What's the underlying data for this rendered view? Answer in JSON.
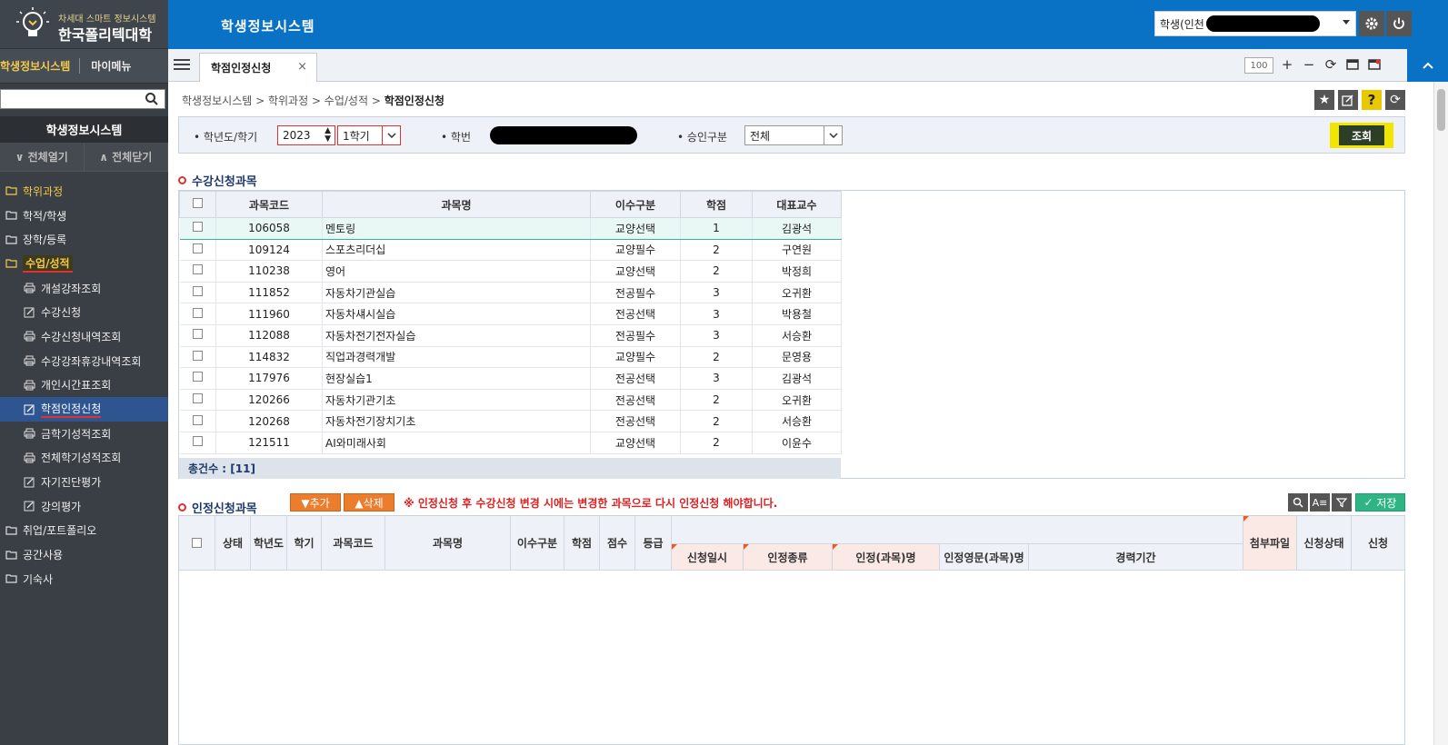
{
  "brand": {
    "subtitle": "차세대 스마트 정보시스템",
    "name": "한국폴리텍대학"
  },
  "sidebar": {
    "tab_active": "학생정보시스템",
    "tab_other": "마이메뉴",
    "search_placeholder": "",
    "menu_title": "학생정보시스템",
    "expand_all": "전체열기",
    "collapse_all": "전체닫기",
    "root": "학위과정",
    "items": [
      {
        "label": "학적/학생",
        "level": 0
      },
      {
        "label": "장학/등록",
        "level": 0
      },
      {
        "label": "수업/성적",
        "level": 0,
        "open": true
      },
      {
        "label": "개설강좌조회",
        "level": 1,
        "icon": "printer-icon"
      },
      {
        "label": "수강신청",
        "level": 1,
        "icon": "edit-icon"
      },
      {
        "label": "수강신청내역조회",
        "level": 1,
        "icon": "printer-icon"
      },
      {
        "label": "수강강좌휴강내역조회",
        "level": 1,
        "icon": "printer-icon"
      },
      {
        "label": "개인시간표조회",
        "level": 1,
        "icon": "printer-icon"
      },
      {
        "label": "학점인정신청",
        "level": 1,
        "icon": "edit-icon",
        "selected": true
      },
      {
        "label": "금학기성적조회",
        "level": 1,
        "icon": "printer-icon"
      },
      {
        "label": "전체학기성적조회",
        "level": 1,
        "icon": "printer-icon"
      },
      {
        "label": "자기진단평가",
        "level": 1,
        "icon": "edit-icon"
      },
      {
        "label": "강의평가",
        "level": 1,
        "icon": "edit-icon"
      },
      {
        "label": "취업/포트폴리오",
        "level": 0
      },
      {
        "label": "공간사용",
        "level": 0
      },
      {
        "label": "기숙사",
        "level": 0
      }
    ]
  },
  "header": {
    "title": "학생정보시스템",
    "user_prefix": "학생(인천"
  },
  "tabbar": {
    "tab_label": "학점인정신청",
    "close": "×",
    "zoom": "100"
  },
  "breadcrumb": {
    "path": "학생정보시스템 > 학위과정 > 수업/성적 > ",
    "current": "학점인정신청"
  },
  "filter": {
    "year_label": "학년도/학기",
    "year": "2023",
    "term": "1학기",
    "student_id_label": "학번",
    "approval_label": "승인구분",
    "approval": "전체",
    "search_btn": "조회"
  },
  "section1": {
    "title": "수강신청과목",
    "total_label": "총건수 : [11]"
  },
  "grid1": {
    "headers": [
      "과목코드",
      "과목명",
      "이수구분",
      "학점",
      "대표교수"
    ],
    "rows": [
      [
        "106058",
        "멘토링",
        "교양선택",
        "1",
        "김광석"
      ],
      [
        "109124",
        "스포츠리더십",
        "교양필수",
        "2",
        "구연원"
      ],
      [
        "110238",
        "영어",
        "교양선택",
        "2",
        "박정희"
      ],
      [
        "111852",
        "자동차기관실습",
        "전공필수",
        "3",
        "오귀환"
      ],
      [
        "111960",
        "자동차섀시실습",
        "전공선택",
        "3",
        "박용철"
      ],
      [
        "112088",
        "자동차전기전자실습",
        "전공필수",
        "3",
        "서승환"
      ],
      [
        "114832",
        "직업과경력개발",
        "교양필수",
        "2",
        "문영용"
      ],
      [
        "117976",
        "현장실습1",
        "전공선택",
        "3",
        "김광석"
      ],
      [
        "120266",
        "자동차기관기초",
        "전공선택",
        "2",
        "오귀환"
      ],
      [
        "120268",
        "자동차전기장치기초",
        "전공선택",
        "2",
        "서승환"
      ],
      [
        "121511",
        "AI와미래사회",
        "교양선택",
        "2",
        "이윤수"
      ]
    ]
  },
  "section2": {
    "title": "인정신청과목",
    "add_btn": "▼추가",
    "delete_btn": "▲삭제",
    "notice": "※ 인정신청 후 수강신청 변경 시에는 변경한 과목으로 다시 인정신청 해야합니다.",
    "save_btn": "저장",
    "filter_btn": "A≡"
  },
  "grid2": {
    "headers": [
      "상태",
      "학년도",
      "학기",
      "과목코드",
      "과목명",
      "이수구분",
      "학점",
      "점수",
      "등급"
    ],
    "sub_headers": [
      "신청일시",
      "인정종류",
      "인정(과목)명",
      "인정영문(과목)명",
      "경력기간"
    ],
    "tail_headers": [
      "첨부파일",
      "신청상태",
      "신청"
    ]
  },
  "colors": {
    "topbar": "#0a72c4",
    "sidebar": "#3a3f45",
    "accent_yellow": "#f2c94c",
    "orange": "#ec7d2d",
    "save_green": "#2fb585",
    "notice_red": "#e02020"
  }
}
